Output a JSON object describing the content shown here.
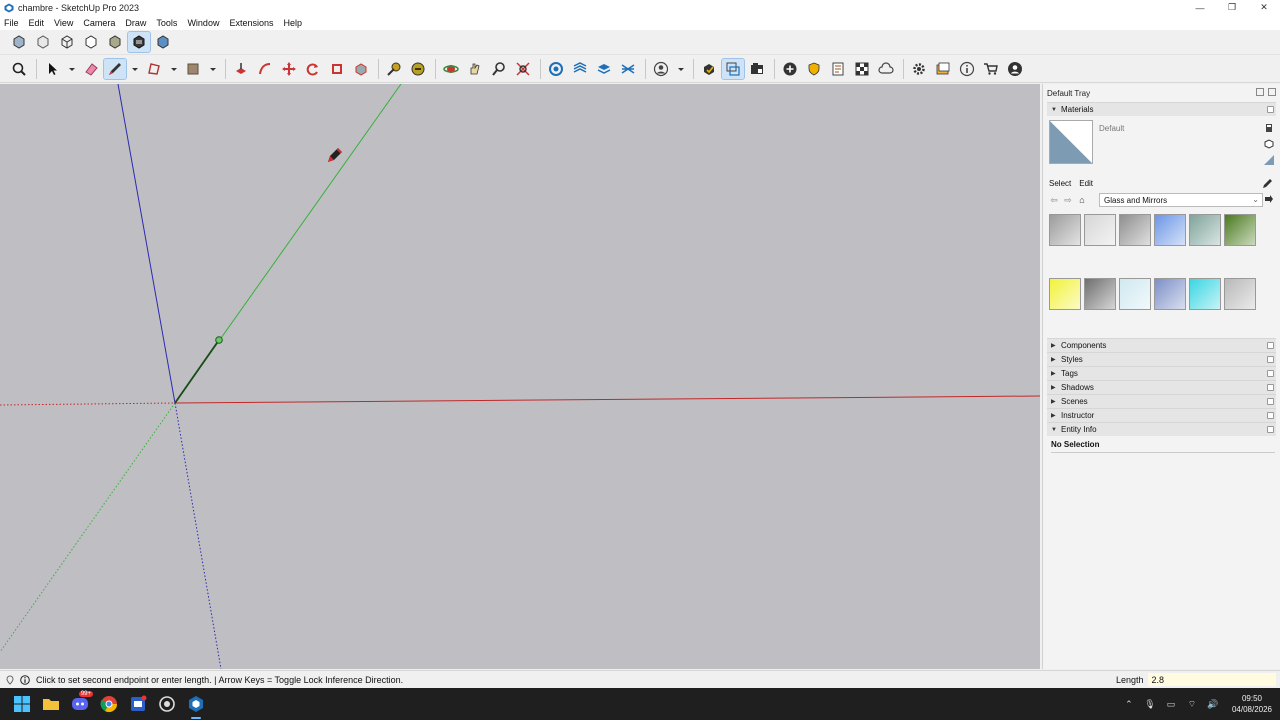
{
  "window": {
    "title": "chambre - SketchUp Pro 2023",
    "controls": [
      "—",
      "❐",
      "✕"
    ]
  },
  "menu": [
    "File",
    "Edit",
    "View",
    "Camera",
    "Draw",
    "Tools",
    "Window",
    "Extensions",
    "Help"
  ],
  "tray": {
    "title": "Default Tray",
    "materials": {
      "header": "Materials",
      "current_name": "Default",
      "tab_select": "Select",
      "tab_edit": "Edit",
      "library": "Glass and Mirrors",
      "swatch_colors": [
        "#9c9c9c",
        "#d6d6d6",
        "#8f8f8f",
        "#6c96e6",
        "#7fa39a",
        "#4a7a1e",
        "#f2f23a",
        "#6f6f6f",
        "#cfe9f0",
        "#7c8fc7",
        "#3ad6e3",
        "#b8b8b8"
      ]
    },
    "panels": [
      "Components",
      "Styles",
      "Tags",
      "Shadows",
      "Scenes",
      "Instructor"
    ],
    "entity_info": {
      "header": "Entity Info",
      "selection": "No Selection"
    }
  },
  "status": {
    "hint": "Click to set second endpoint or enter length. | Arrow Keys = Toggle Lock Inference Direction.",
    "measurement_label": "Length",
    "measurement_value": "2.8"
  },
  "taskbar": {
    "discord_badge": "99+",
    "clock_time": "09:50",
    "clock_date": "04/08/2026"
  },
  "colors": {
    "viewport_bg": "#bfbfc3",
    "red_axis": "#c0282a",
    "green_axis": "#38b03a",
    "blue_axis": "#2a2ab0"
  }
}
